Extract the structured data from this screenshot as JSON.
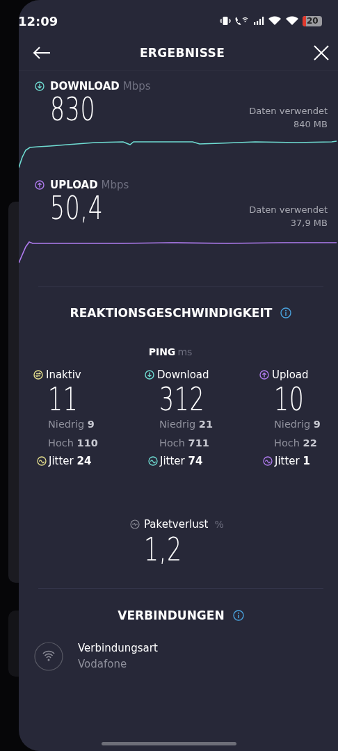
{
  "status_bar": {
    "time": "12:09",
    "battery": "20"
  },
  "header": {
    "title": "ERGEBNISSE"
  },
  "speeds": [
    {
      "kind": "download",
      "label": "DOWNLOAD",
      "unit": "Mbps",
      "value": "830",
      "data_label": "Daten verwendet",
      "data_value": "840 MB"
    },
    {
      "kind": "upload",
      "label": "UPLOAD",
      "unit": "Mbps",
      "value": "50,4",
      "data_label": "Daten verwendet",
      "data_value": "37,9 MB"
    }
  ],
  "responsiveness": {
    "title": "REAKTIONSGESCHWINDIGKEIT",
    "ping_label": "PING",
    "ping_unit": "ms",
    "columns": [
      {
        "kind": "idle",
        "label": "Inaktiv",
        "value": "11",
        "low": "Niedrig **9**",
        "high": "Hoch **110**",
        "jitter": "Jitter **24**"
      },
      {
        "kind": "download",
        "label": "Download",
        "value": "312",
        "low": "Niedrig **21**",
        "high": "Hoch **711**",
        "jitter": "Jitter **74**"
      },
      {
        "kind": "upload",
        "label": "Upload",
        "value": "10",
        "low": "Niedrig **9**",
        "high": "Hoch **22**",
        "jitter": "Jitter **1**"
      }
    ],
    "packet_loss": {
      "label": "Paketverlust",
      "unit": "%",
      "value": "1,2"
    }
  },
  "connections": {
    "title": "VERBINDUNGEN",
    "items": [
      {
        "label": "Verbindungsart",
        "value": "Vodafone"
      }
    ]
  }
}
